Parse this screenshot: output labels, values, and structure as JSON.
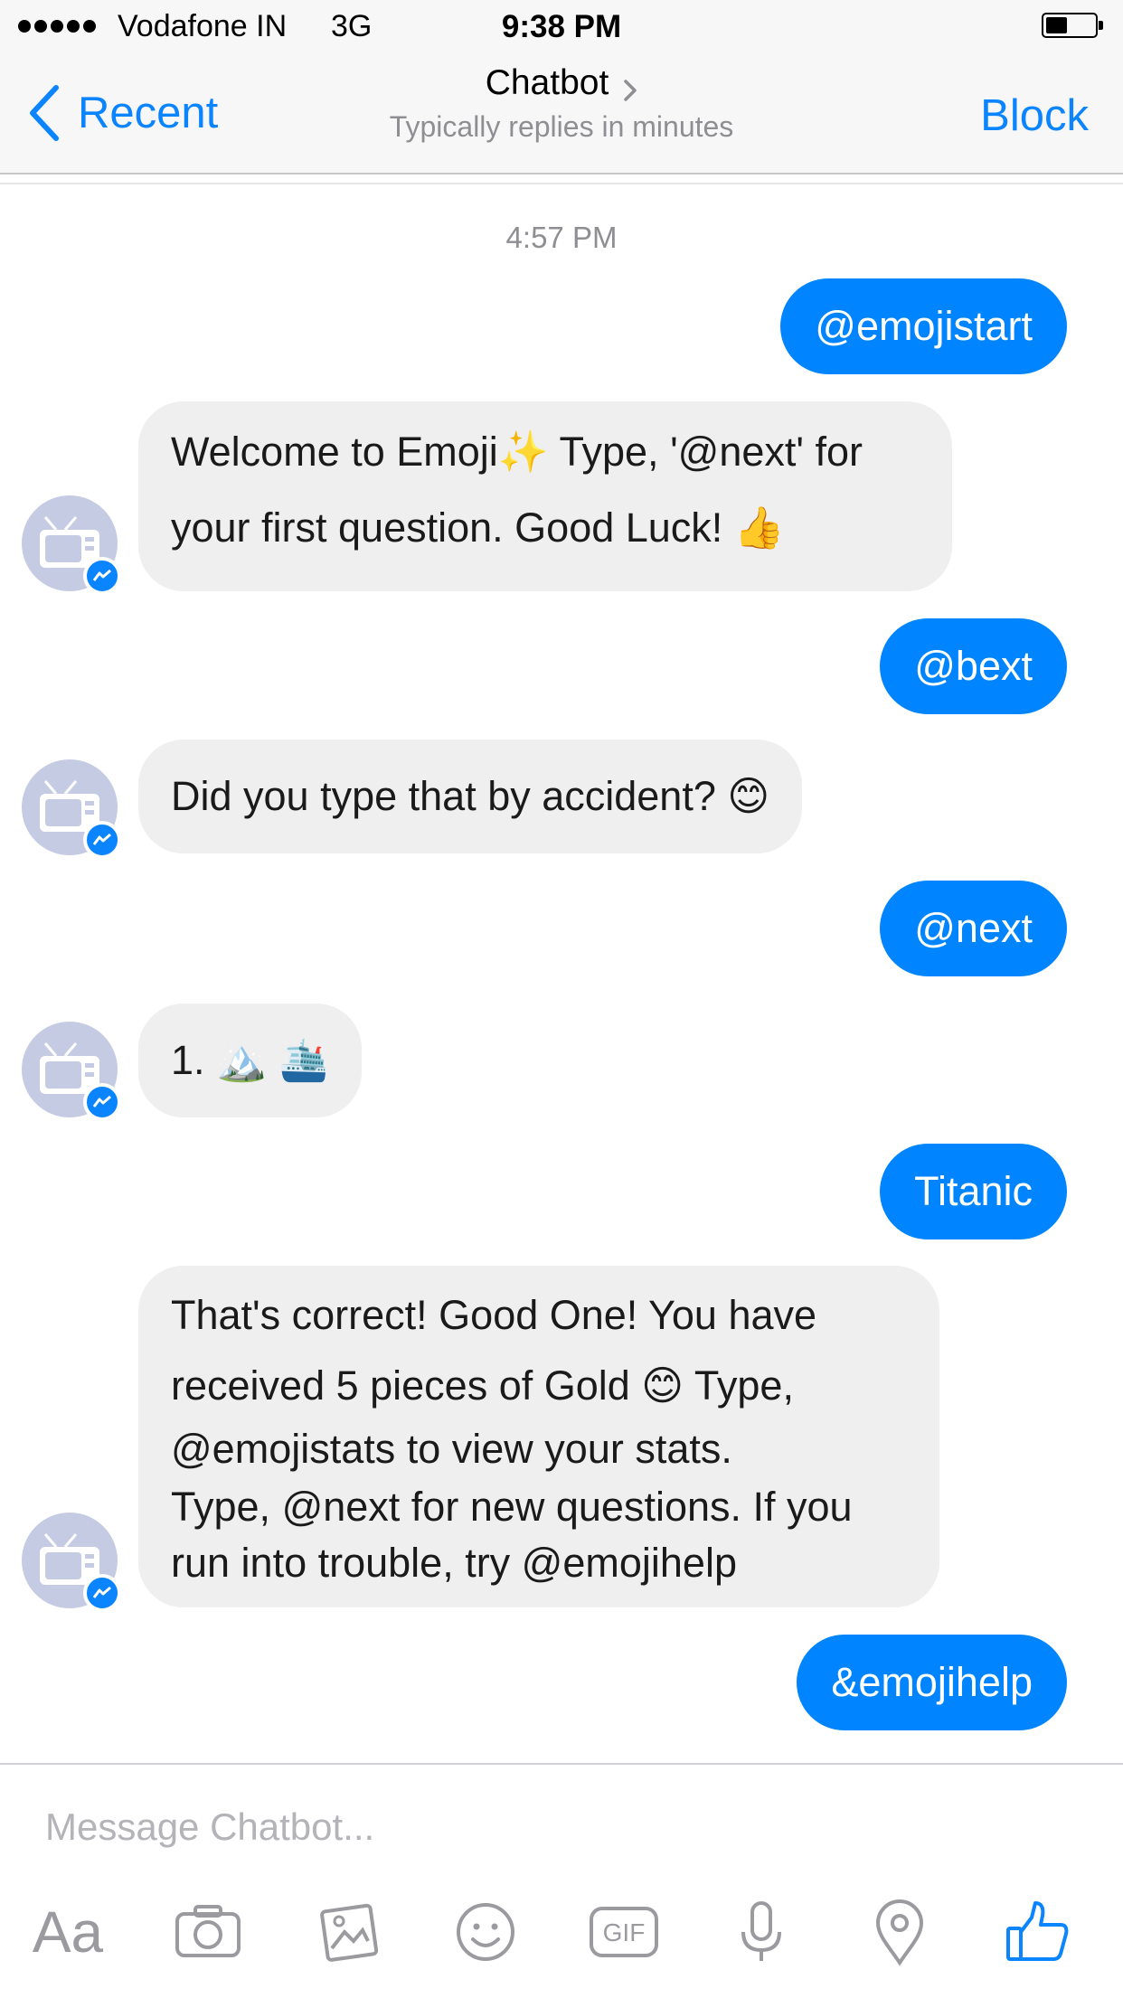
{
  "status_bar": {
    "carrier": "Vodafone IN",
    "network": "3G",
    "time": "9:38 PM",
    "battery_level": 0.45
  },
  "nav": {
    "back_label": "Recent",
    "title": "Chatbot",
    "subtitle": "Typically replies in minutes",
    "action_label": "Block",
    "accent_color": "#0a84ff"
  },
  "chat": {
    "timestamp": "4:57 PM",
    "messages": [
      {
        "from": "me",
        "text": "@emojistart"
      },
      {
        "from": "bot",
        "lines": [
          "Welcome to Emoji✨ Type, '@next' for",
          "your first question. Good Luck! 👍"
        ]
      },
      {
        "from": "me",
        "text": "@bext"
      },
      {
        "from": "bot",
        "lines": [
          "Did you type that by accident? 😊"
        ]
      },
      {
        "from": "me",
        "text": "@next"
      },
      {
        "from": "bot",
        "lines": [
          "1. 🏔️ 🛳️"
        ]
      },
      {
        "from": "me",
        "text": "Titanic"
      },
      {
        "from": "bot",
        "lines": [
          "That's correct! Good One! You have",
          "received 5 pieces of Gold 😊 Type,",
          "@emojistats to view your stats.",
          "Type, @next for new questions. If you",
          "run into trouble, try @emojihelp"
        ]
      },
      {
        "from": "me",
        "text": "&emojihelp"
      }
    ],
    "colors": {
      "outgoing": "#0084ff",
      "incoming": "#efeff0"
    }
  },
  "composer": {
    "placeholder": "Message Chatbot...",
    "text_format_label": "Aa",
    "gif_label": "GIF",
    "icons": [
      "text-format-icon",
      "camera-icon",
      "photo-icon",
      "emoji-icon",
      "gif-icon",
      "microphone-icon",
      "location-icon",
      "thumbs-up-icon"
    ]
  }
}
